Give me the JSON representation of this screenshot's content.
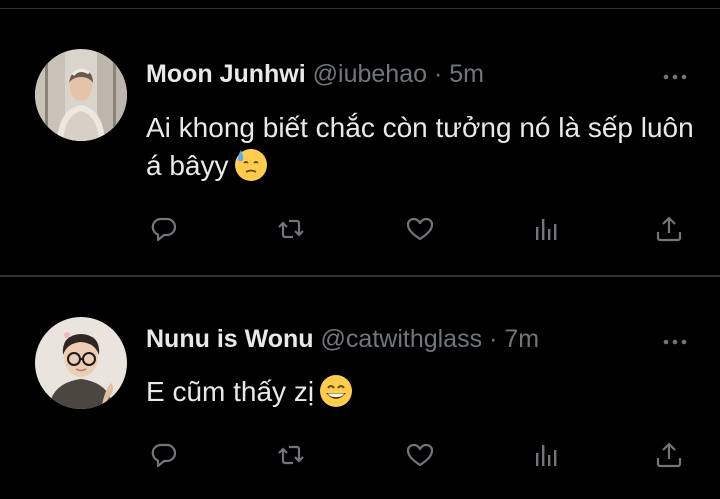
{
  "tweets": [
    {
      "name": "Moon Junhwi",
      "handle": "@iubehao",
      "separator": "·",
      "time": "5m",
      "text": "Ai khong biết chắc còn tưởng nó là sếp luôn á bâyy",
      "emoji": "downcast-face-with-sweat",
      "avatar": "profile-photo"
    },
    {
      "name": "Nunu is Wonu",
      "handle": "@catwithglass",
      "separator": "·",
      "time": "7m",
      "text": "E cũm thấy zị",
      "emoji": "grinning-face-with-smiling-eyes",
      "avatar": "profile-photo"
    }
  ],
  "icons": {
    "reply": "reply-icon",
    "retweet": "retweet-icon",
    "like": "like-icon",
    "views": "views-icon",
    "share": "share-icon",
    "more": "more-icon"
  },
  "colors": {
    "background": "#000000",
    "text_primary": "#e7e9ea",
    "text_secondary": "#71767b",
    "divider": "#2f3336"
  }
}
